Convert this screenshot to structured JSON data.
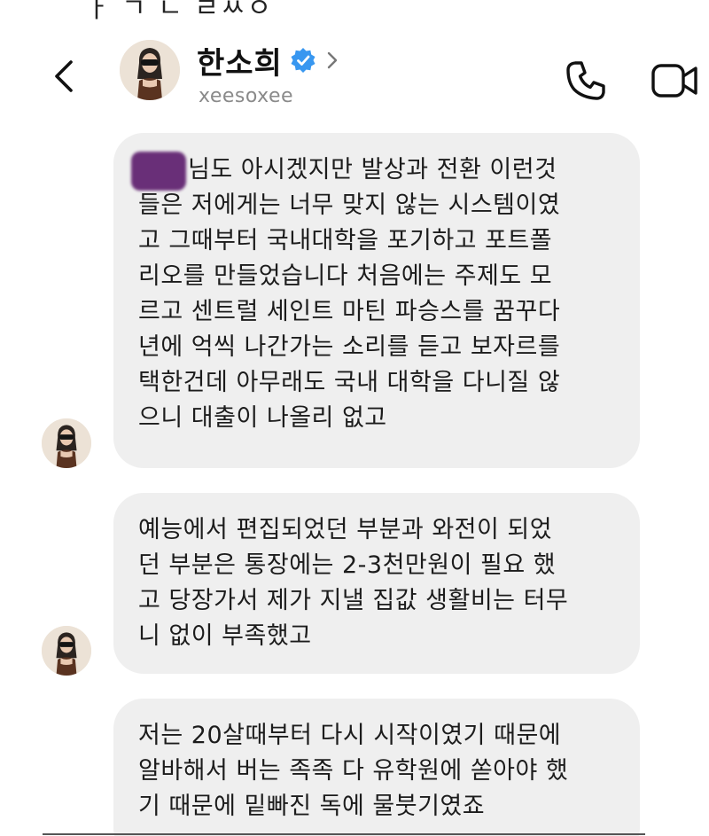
{
  "header": {
    "contact_name": "한소희",
    "username": "xeesoxee",
    "icons": {
      "back": "back-chevron-icon",
      "verified": "verified-badge-icon",
      "profile": "chevron-right-icon",
      "call": "phone-icon",
      "video": "video-camera-icon"
    }
  },
  "messages": [
    {
      "redacted_prefix": true,
      "lines": [
        "님도 아시겠지만 발상과 전환 이런것",
        "들은 저에게는 너무 맞지 않는 시스템이였",
        "고 그때부터 국내대학을 포기하고 포트폴",
        "리오를 만들었습니다 처음에는 주제도 모",
        "르고 센트럴 세인트 마틴 파승스를 꿈꾸다",
        "년에 억씩 나간가는 소리를 듣고 보자르를",
        "택한건데 아무래도 국내 대학을 다니질 않",
        "으니 대출이 나올리 없고"
      ]
    },
    {
      "redacted_prefix": false,
      "lines": [
        "예능에서 편집되었던 부분과 와전이 되었",
        "던 부분은 통장에는 2-3천만원이 필요 했",
        "고 당장가서 제가 지낼 집값 생활비는 터무",
        "니 없이 부족했고"
      ]
    },
    {
      "redacted_prefix": false,
      "lines": [
        "저는 20살때부터 다시 시작이였기 때문에",
        "알바해서 버는 족족 다 유학원에 쏟아야 했",
        "기 때문에 밑빠진 독에 물붓기였죠"
      ]
    }
  ],
  "colors": {
    "bubble": "#efefef",
    "verified_blue": "#3897f0",
    "redaction": "#5e1f6e"
  }
}
